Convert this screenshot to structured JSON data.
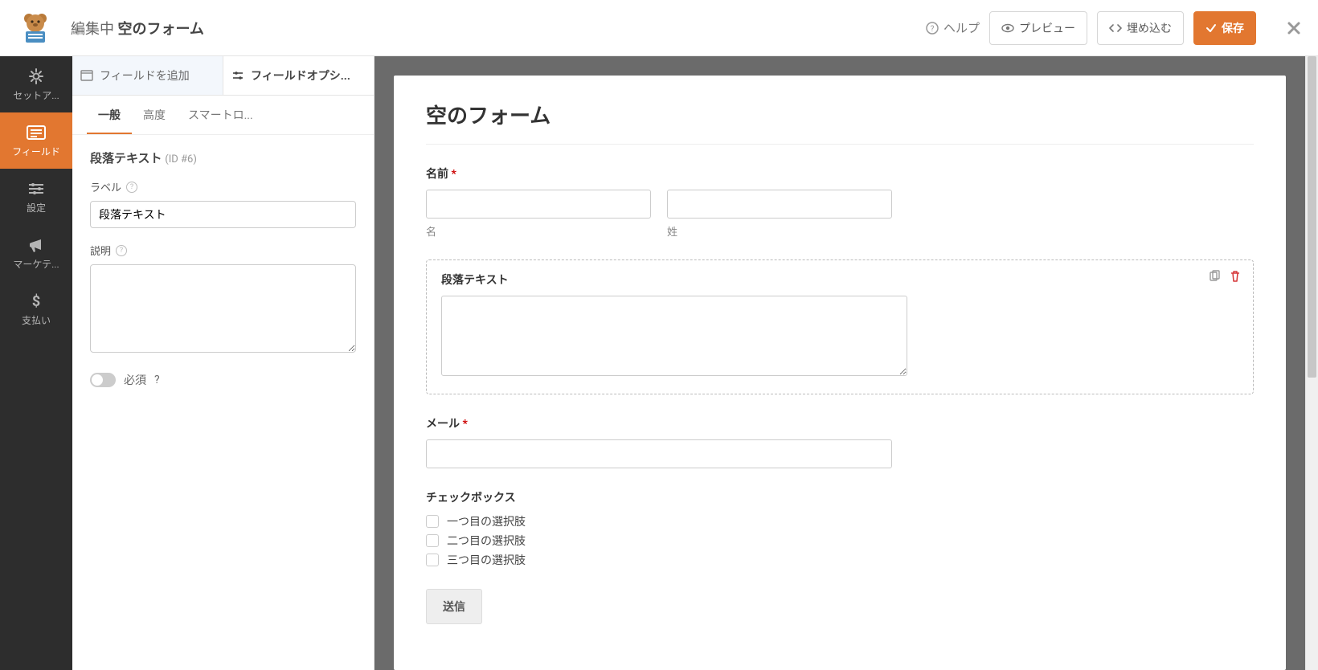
{
  "topbar": {
    "title_prefix": "編集中",
    "title_name": "空のフォーム",
    "help": "ヘルプ",
    "preview": "プレビュー",
    "embed": "埋め込む",
    "save": "保存"
  },
  "leftnav": {
    "items": [
      {
        "label": "セットア...",
        "icon": "gear"
      },
      {
        "label": "フィールド",
        "icon": "form"
      },
      {
        "label": "設定",
        "icon": "sliders"
      },
      {
        "label": "マーケテ...",
        "icon": "bullhorn"
      },
      {
        "label": "支払い",
        "icon": "dollar"
      }
    ],
    "active_index": 1
  },
  "sidebar": {
    "tabs": [
      {
        "label": "フィールドを追加"
      },
      {
        "label": "フィールドオプシ..."
      }
    ],
    "active_tab": 1,
    "subtabs": [
      "一般",
      "高度",
      "スマートロ..."
    ],
    "active_subtab": 0,
    "field_type_name": "段落テキスト",
    "field_id_text": "(ID #6)",
    "label_label": "ラベル",
    "label_value": "段落テキスト",
    "description_label": "説明",
    "description_value": "",
    "required_label": "必須"
  },
  "preview": {
    "form_title": "空のフォーム",
    "name": {
      "label": "名前",
      "required": "*",
      "first_sublabel": "名",
      "last_sublabel": "姓"
    },
    "paragraph": {
      "label": "段落テキスト"
    },
    "email": {
      "label": "メール",
      "required": "*"
    },
    "checkbox": {
      "label": "チェックボックス",
      "options": [
        "一つ目の選択肢",
        "二つ目の選択肢",
        "三つ目の選択肢"
      ]
    },
    "submit_label": "送信"
  }
}
